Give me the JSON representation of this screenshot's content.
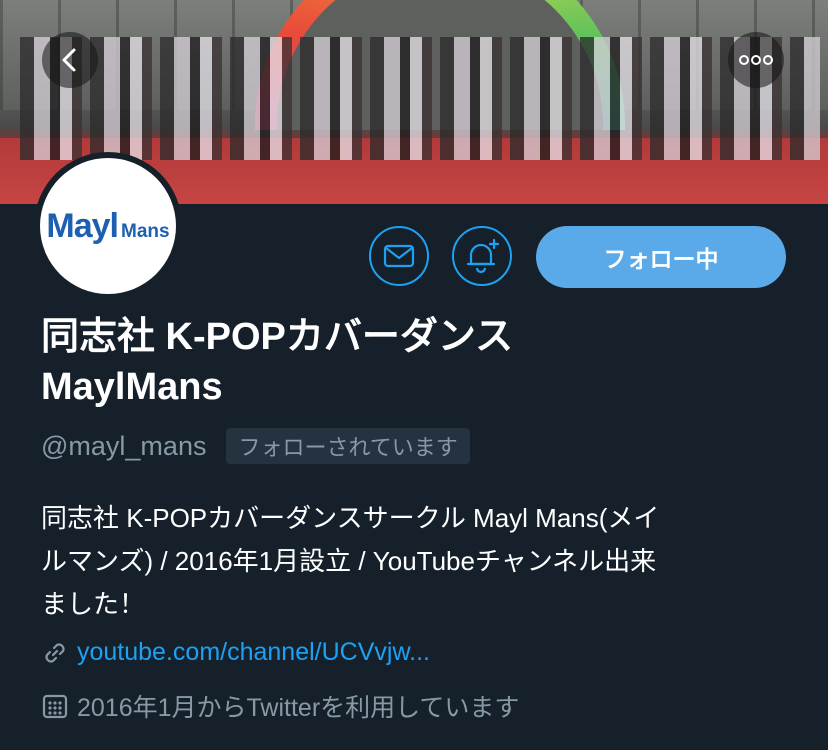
{
  "banner": {
    "image": "group-photo-banner"
  },
  "nav": {
    "back_icon": "chevron-left-icon",
    "more_icon": "more-dots-icon"
  },
  "avatar": {
    "logo_big": "Mayl",
    "logo_small": "Mans"
  },
  "actions": {
    "mail_icon": "mail-icon",
    "notify_icon": "bell-plus-icon",
    "follow_label": "フォロー中"
  },
  "profile": {
    "name_line1": "同志社 K-POPカバーダンス",
    "name_line2": "MaylMans",
    "handle": "@mayl_mans",
    "follows_you": "フォローされています",
    "bio_line1": "同志社 K-POPカバーダンスサークル Mayl Mans(メイ",
    "bio_line2": "ルマンズ) / 2016年1月設立 / YouTubeチャンネル出来",
    "bio_line3": "ました！",
    "link": "youtube.com/channel/UCVvjw...",
    "joined": "2016年1月からTwitterを利用しています"
  },
  "colors": {
    "background": "#15202b",
    "accent": "#1da1f2",
    "follow_button": "#5aa9e9",
    "muted": "#8899a6"
  }
}
